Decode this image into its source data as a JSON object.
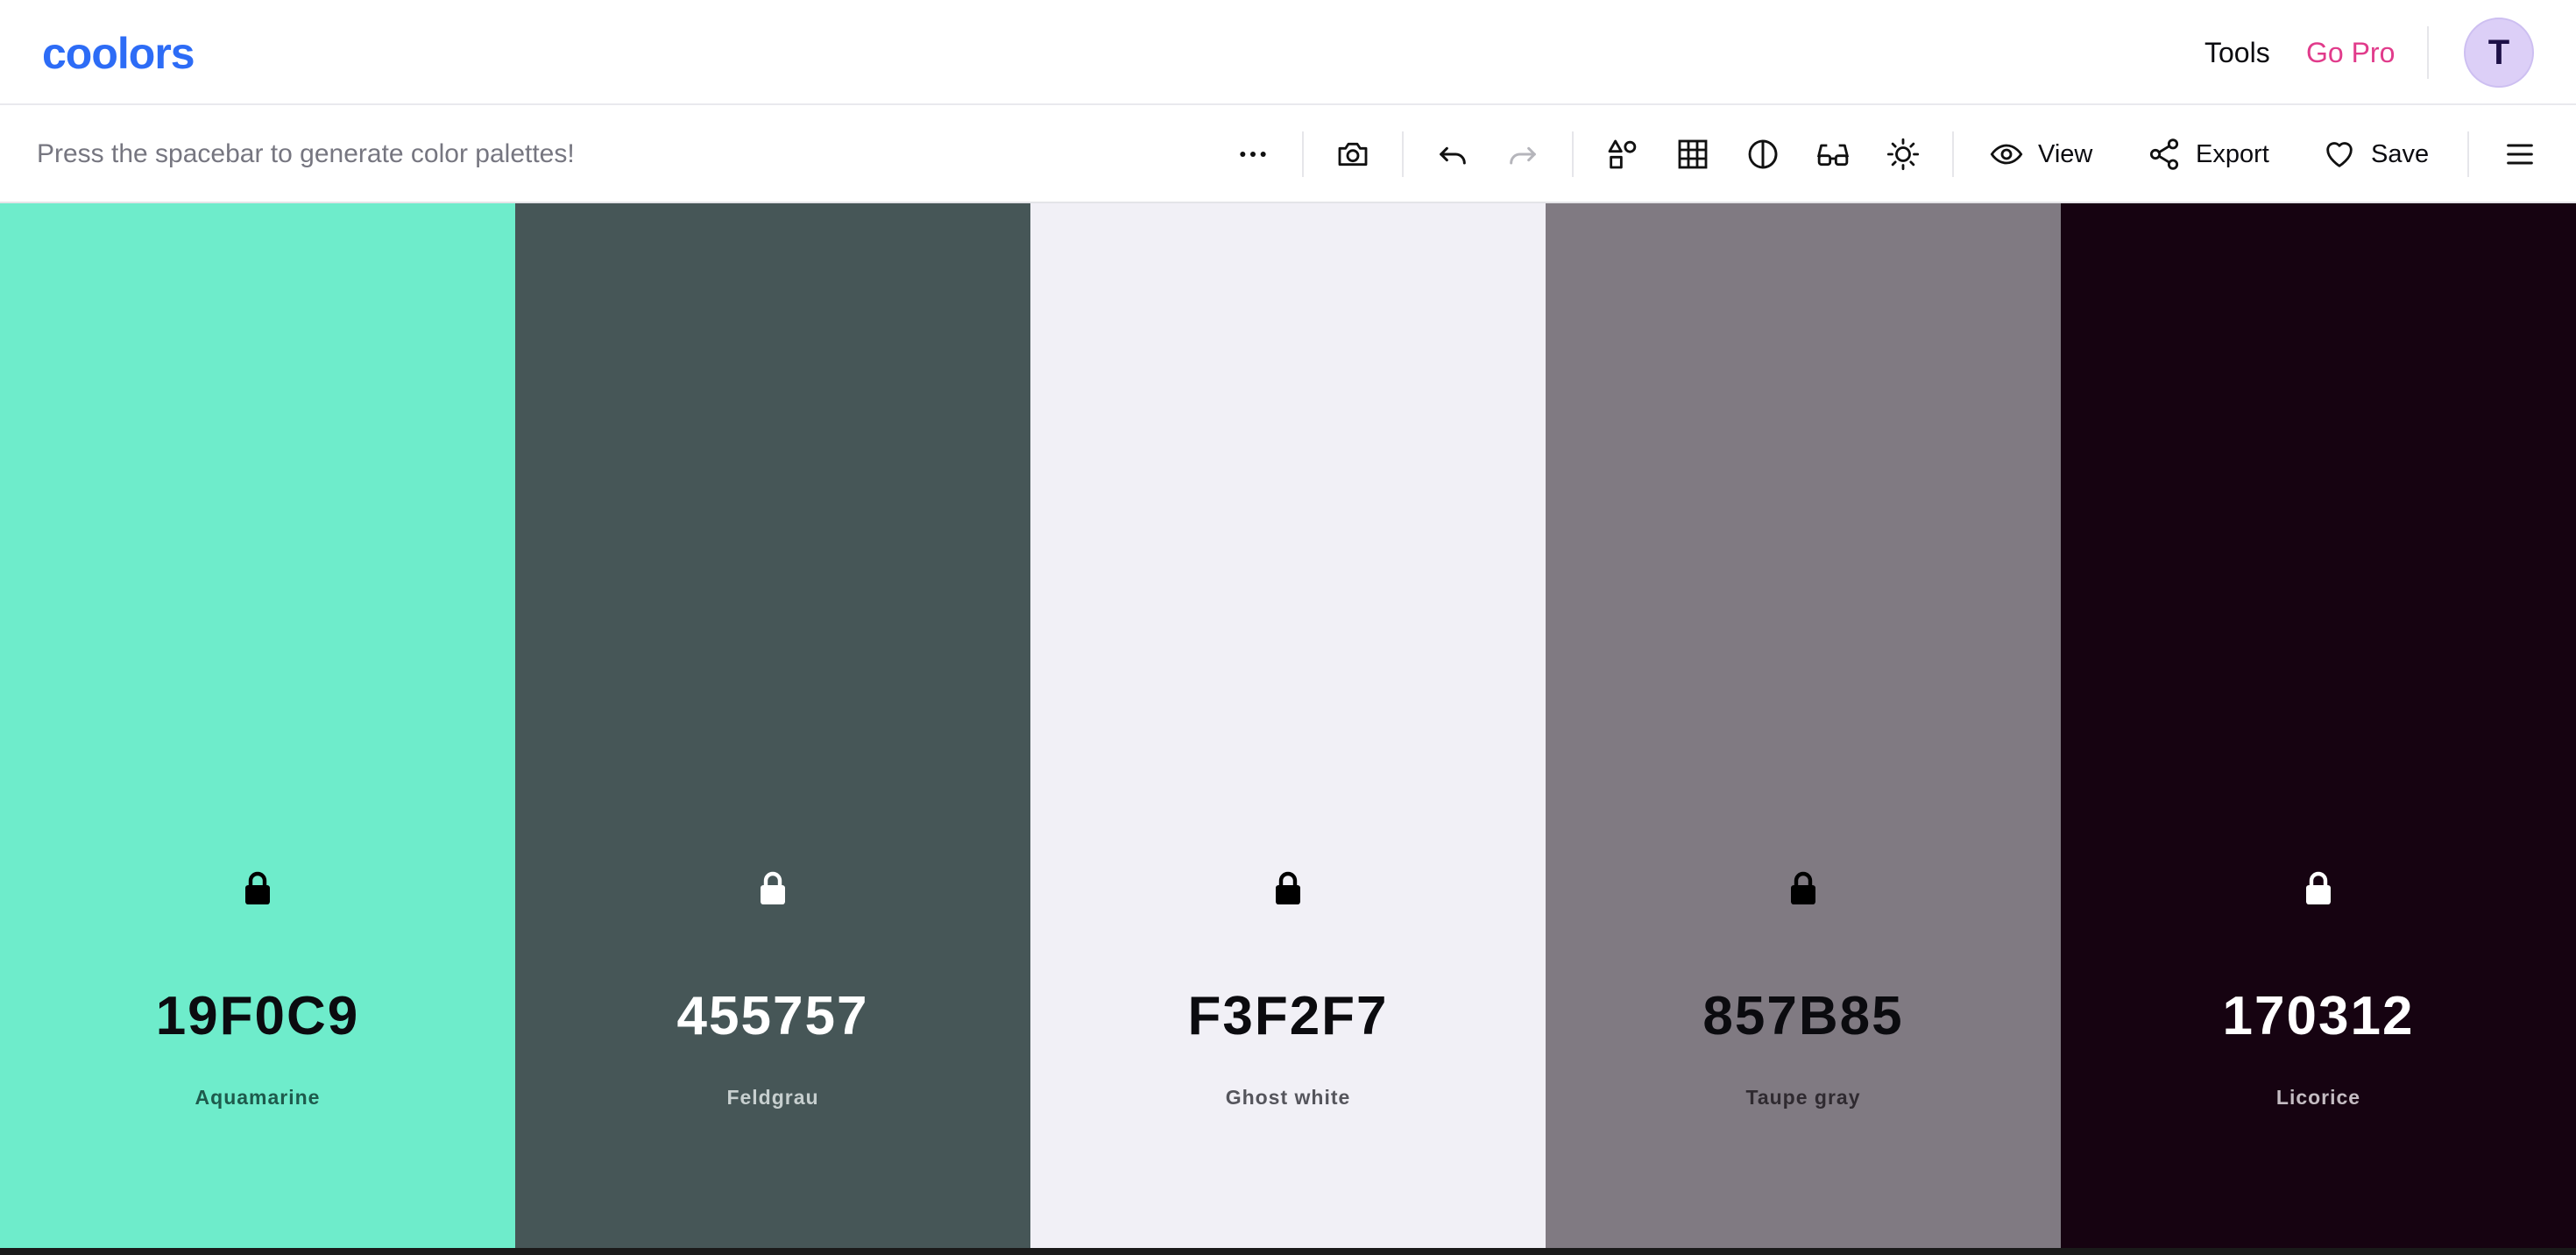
{
  "app": {
    "logo_text": "coolors",
    "brand_color": "#2d6cf6"
  },
  "topnav": {
    "tools_label": "Tools",
    "gopro_label": "Go Pro",
    "gopro_color": "#e13b8b",
    "avatar_initial": "T"
  },
  "toolbar": {
    "hint": "Press the spacebar to generate color palettes!",
    "icons": [
      "more-icon",
      "camera-icon",
      "undo-icon",
      "redo-icon",
      "shapes-icon",
      "grid-icon",
      "contrast-icon",
      "glasses-icon",
      "brightness-icon",
      "menu-icon"
    ],
    "view_label": "View",
    "export_label": "Export",
    "save_label": "Save"
  },
  "palette": [
    {
      "hex": "19F0C9",
      "name": "Aquamarine",
      "bg": "#6eeccb",
      "text": "#0b0b0f",
      "name_color": "#1e5a4c",
      "lock_color": "#000000"
    },
    {
      "hex": "455757",
      "name": "Feldgrau",
      "bg": "#465657",
      "text": "#ffffff",
      "name_color": "#c7cfcf",
      "lock_color": "#ffffff"
    },
    {
      "hex": "F3F2F7",
      "name": "Ghost white",
      "bg": "#f1f0f6",
      "text": "#0b0b0f",
      "name_color": "#55555c",
      "lock_color": "#000000"
    },
    {
      "hex": "857B85",
      "name": "Taupe gray",
      "bg": "#807a82",
      "text": "#0b0b0f",
      "name_color": "#2f2a30",
      "lock_color": "#000000"
    },
    {
      "hex": "170312",
      "name": "Licorice",
      "bg": "#160311",
      "text": "#ffffff",
      "name_color": "#c4bcc2",
      "lock_color": "#ffffff"
    }
  ]
}
